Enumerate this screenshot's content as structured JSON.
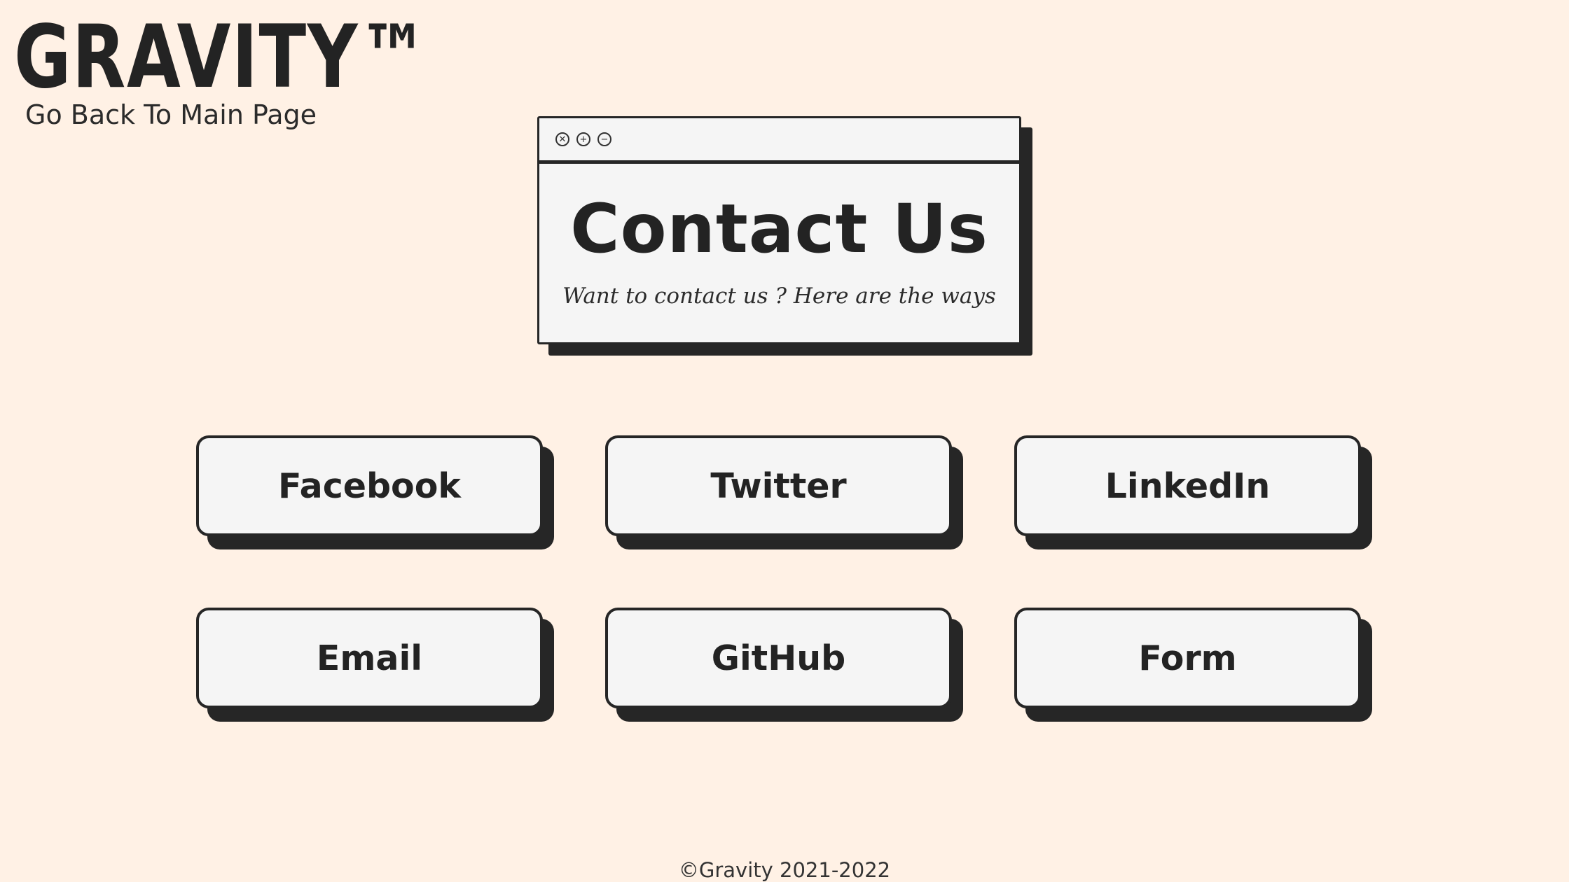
{
  "header": {
    "logo": "GRAVITY™",
    "back_link": "Go Back To Main Page"
  },
  "window": {
    "controls": {
      "close_glyph": "✕",
      "maximize_glyph": "+",
      "minimize_glyph": "−"
    },
    "title": "Contact Us",
    "subtitle": "Want to contact us ? Here are the ways"
  },
  "contact_buttons": [
    {
      "label": "Facebook"
    },
    {
      "label": "Twitter"
    },
    {
      "label": "LinkedIn"
    },
    {
      "label": "Email"
    },
    {
      "label": "GitHub"
    },
    {
      "label": "Form"
    }
  ],
  "footer": {
    "copyright": "©Gravity 2021-2022"
  },
  "colors": {
    "background": "#fff1e5",
    "panel": "#f5f5f5",
    "ink": "#262626"
  }
}
